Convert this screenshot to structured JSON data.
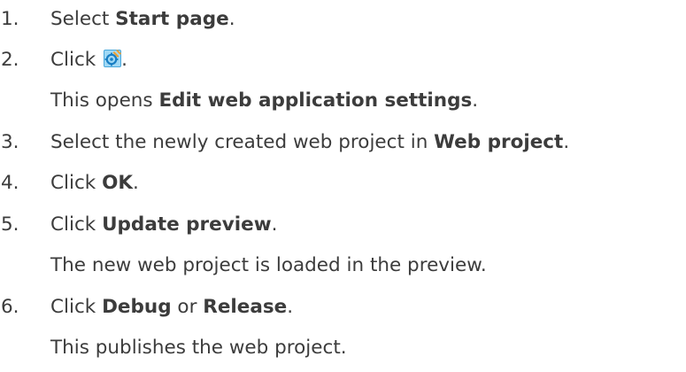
{
  "steps": [
    {
      "num": "1.",
      "pre": "Select ",
      "bold": "Start page",
      "post": "."
    },
    {
      "num": "2.",
      "pre": "Click ",
      "icon": "settings-gear-icon",
      "post": ".",
      "note": {
        "pre": "This opens ",
        "bold": "Edit web application settings",
        "post": "."
      }
    },
    {
      "num": "3.",
      "pre": "Select the newly created web project in ",
      "bold": "Web project",
      "post": "."
    },
    {
      "num": "4.",
      "pre": "Click ",
      "bold": "OK",
      "post": "."
    },
    {
      "num": "5.",
      "pre": "Click ",
      "bold": "Update preview",
      "post": ".",
      "note": "The new web project is loaded in the preview."
    },
    {
      "num": "6.",
      "pre": "Click ",
      "bold": "Debug",
      "mid": " or ",
      "bold2": "Release",
      "post": ".",
      "note": "This publishes the web project."
    }
  ],
  "colors": {
    "text": "#3c3c3c",
    "icon_light": "#9fd8f5",
    "icon_dark": "#1a7fc4",
    "icon_orange": "#f0a030"
  }
}
